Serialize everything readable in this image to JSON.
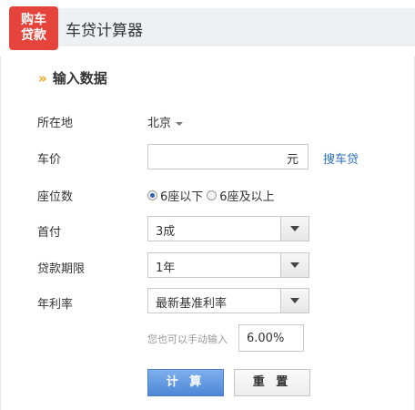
{
  "header": {
    "badge_line1": "购车",
    "badge_line2": "贷款",
    "title": "车贷计算器"
  },
  "section": {
    "arrow": "»",
    "title": "输入数据"
  },
  "form": {
    "location": {
      "label": "所在地",
      "value": "北京"
    },
    "price": {
      "label": "车价",
      "value": "",
      "unit": "元",
      "link": "搜车贷"
    },
    "seats": {
      "label": "座位数",
      "options": [
        {
          "label": "6座以下",
          "checked": true
        },
        {
          "label": "6座及以上",
          "checked": false
        }
      ]
    },
    "down_payment": {
      "label": "首付",
      "value": "3成"
    },
    "term": {
      "label": "贷款期限",
      "value": "1年"
    },
    "rate": {
      "label": "年利率",
      "value": "最新基准利率",
      "hint": "您也可以手动输入",
      "manual_value": "6.00%"
    }
  },
  "buttons": {
    "calculate": "计 算",
    "reset": "重 置"
  },
  "colors": {
    "badge": "#e4443c",
    "accent_arrow": "#f0a21b",
    "link": "#2a6fb8",
    "primary_button": "#4d87d6"
  }
}
